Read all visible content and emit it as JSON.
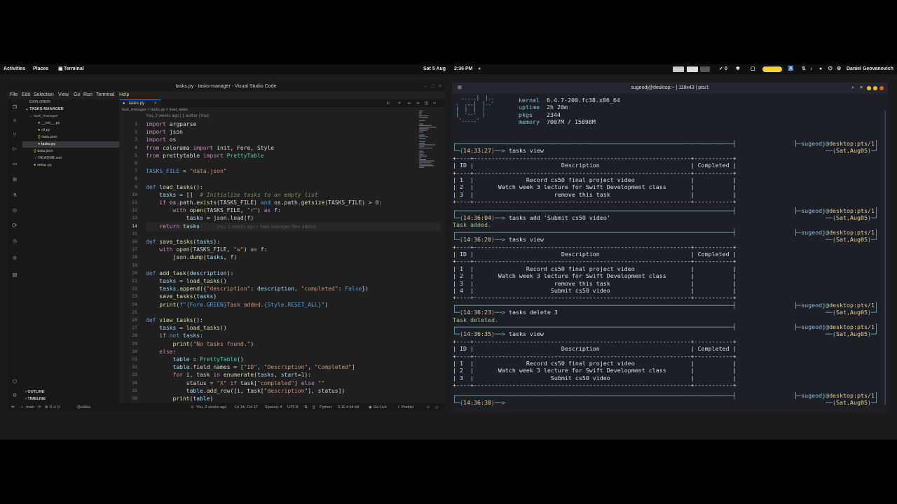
{
  "topbar": {
    "activities": "Activities",
    "places": "Places",
    "terminal": "Terminal",
    "date": "Sat 5 Aug",
    "time": "2:36 PM",
    "check_count": "0",
    "user": "Daniel Geovanovich"
  },
  "vscode": {
    "title": "tasks.py - tasks-manager - Visual Studio Code",
    "menu": [
      "File",
      "Edit",
      "Selection",
      "View",
      "Go",
      "Run",
      "Terminal",
      "Help"
    ],
    "explorer_label": "EXPLORER",
    "project": "TASKS-MANAGER",
    "files": [
      {
        "name": "task_manager",
        "kind": "folder"
      },
      {
        "name": "__init__.py",
        "kind": "py"
      },
      {
        "name": "cli.py",
        "kind": "py"
      },
      {
        "name": "data.json",
        "kind": "json"
      },
      {
        "name": "tasks.py",
        "kind": "py"
      },
      {
        "name": "data.json",
        "kind": "json"
      },
      {
        "name": "README.md",
        "kind": "md"
      },
      {
        "name": "setup.py",
        "kind": "py"
      }
    ],
    "outline": "OUTLINE",
    "timeline": "TIMELINE",
    "tab": "tasks.py",
    "breadcrumb": "task_manager > tasks.py > load_tasks",
    "blame_header": "You, 2 weeks ago | 1 author (You)",
    "inline_blame": "You, 2 weeks ago • Task manager files added.",
    "line_numbers": [
      "1",
      "2",
      "3",
      "4",
      "5",
      "6",
      "7",
      "8",
      "9",
      "10",
      "11",
      "12",
      "13",
      "14",
      "15",
      "16",
      "17",
      "18",
      "19",
      "20",
      "21",
      "22",
      "23",
      "24",
      "25",
      "26",
      "27",
      "28",
      "29",
      "30",
      "31",
      "32",
      "33",
      "34",
      "35",
      "36"
    ],
    "status": {
      "branch": "main",
      "errors": "0 ⚠ 0",
      "quokka": "Quokka",
      "blame": "You, 2 weeks ago",
      "position": "Ln 14, Col 17",
      "spaces": "Spaces: 4",
      "encoding": "UTF-8",
      "language": "Python",
      "interpreter": "3.11.4 64-bit",
      "golive": "Go Live",
      "prettier": "Prettier"
    }
  },
  "terminal": {
    "title": "sugeodj@desktop:~ | 118x43 | pts/1",
    "fetch": {
      "kernel_label": "kernel",
      "kernel": "6.4.7-200.fc38.x86_64",
      "uptime_label": "uptime",
      "uptime": "2h 20m",
      "pkgs_label": "pkgs",
      "pkgs": "2344",
      "memory_label": "memory",
      "memory": "7007M / 15898M"
    },
    "host": "sugeodj",
    "host_loc": "desktop:pts/1",
    "date_tag": "Sat,Aug05",
    "prompts": [
      {
        "time": "14:33:27",
        "cmd": "tasks view"
      },
      {
        "time": "14:36:04",
        "cmd": "tasks add 'Submit cs50 video'"
      },
      {
        "time": "14:36:20",
        "cmd": "tasks view"
      },
      {
        "time": "14:36:23",
        "cmd": "tasks delete 3"
      },
      {
        "time": "14:36:35",
        "cmd": "tasks view"
      },
      {
        "time": "14:36:38",
        "cmd": ""
      }
    ],
    "headers": [
      "ID",
      "Description",
      "Completed"
    ],
    "table1": [
      [
        "1",
        "Record cs50 final project video"
      ],
      [
        "2",
        "Watch week 3 lecture for Swift Development class"
      ],
      [
        "3",
        "remove this task"
      ]
    ],
    "msg_added": "Task added.",
    "table2": [
      [
        "1",
        "Record cs50 final project video"
      ],
      [
        "2",
        "Watch week 3 lecture for Swift Development class"
      ],
      [
        "3",
        "remove this task"
      ],
      [
        "4",
        "Submit cs50 video"
      ]
    ],
    "msg_deleted": "Task deleted.",
    "table3": [
      [
        "1",
        "Record cs50 final project video"
      ],
      [
        "2",
        "Watch week 3 lecture for Swift Development class"
      ],
      [
        "3",
        "Submit cs50 video"
      ]
    ]
  }
}
